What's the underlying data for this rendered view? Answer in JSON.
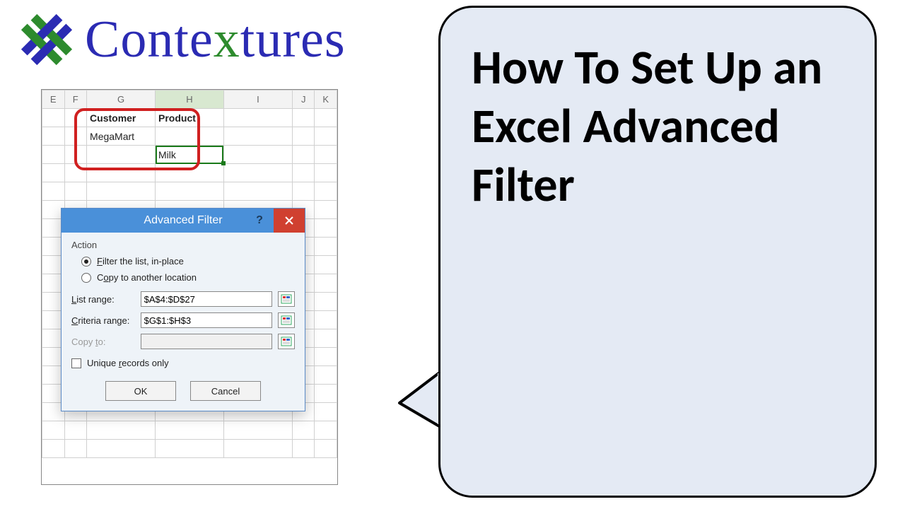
{
  "logo": {
    "name_pre": "Conte",
    "name_x": "x",
    "name_post": "tures"
  },
  "sheet": {
    "cols": [
      "E",
      "F",
      "G",
      "H",
      "I",
      "J",
      "K"
    ],
    "selected_col_index": 3,
    "headers": {
      "customer": "Customer",
      "product": "Product"
    },
    "row2": {
      "customer": "MegaMart",
      "product": ""
    },
    "row3": {
      "customer": "",
      "product": "Milk"
    }
  },
  "dialog": {
    "title": "Advanced Filter",
    "section_action": "Action",
    "opt_inplace": "Filter the list, in-place",
    "opt_copy": "Copy to another location",
    "lbl_list": "List range:",
    "lbl_crit": "Criteria range:",
    "lbl_copy": "Copy to:",
    "val_list": "$A$4:$D$27",
    "val_crit": "$G$1:$H$3",
    "val_copy": "",
    "chk_unique": "Unique records only",
    "btn_ok": "OK",
    "btn_cancel": "Cancel"
  },
  "bubble_text": "How To Set Up an Excel Advanced Filter"
}
